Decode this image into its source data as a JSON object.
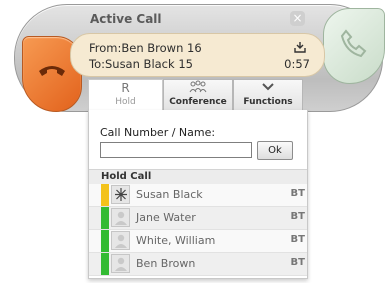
{
  "window": {
    "title": "Active Call",
    "close_glyph": "×"
  },
  "call": {
    "from": "From:Ben Brown 16",
    "to": "To:Susan Black 15",
    "duration": "0:57"
  },
  "tabs": {
    "hold": {
      "icon": "R",
      "label": "Hold"
    },
    "conference": {
      "label": "Conference"
    },
    "functions": {
      "icon": "❯",
      "label": "Functions"
    }
  },
  "panel": {
    "call_number_label": "Call Number / Name:",
    "call_number_value": "",
    "ok_label": "Ok",
    "hold_call_header": "Hold Call"
  },
  "hold_calls": [
    {
      "name": "Susan Black",
      "tag": "BT",
      "status_color": "#f3c21b"
    },
    {
      "name": "Jane Water",
      "tag": "BT",
      "status_color": "#33bb33"
    },
    {
      "name": "White, William",
      "tag": "BT",
      "status_color": "#33bb33"
    },
    {
      "name": "Ben Brown",
      "tag": "BT",
      "status_color": "#33bb33"
    }
  ],
  "colors": {
    "end_call": "#e8712a",
    "answer": "#cfe2cf",
    "info_bg": "#f6ead2"
  }
}
